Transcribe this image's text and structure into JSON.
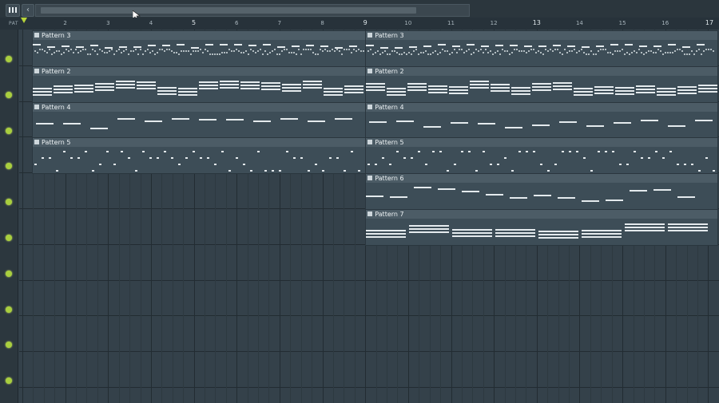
{
  "toolbar": {
    "piano_icon": "piano-keys-icon",
    "back_icon_glyph": "‹"
  },
  "ruler": {
    "pattern_label": "PAT",
    "bars": [
      "2",
      "3",
      "4",
      "5",
      "6",
      "7",
      "8",
      "9",
      "10",
      "11",
      "12",
      "13",
      "14",
      "15",
      "16",
      "17"
    ]
  },
  "tracks": {
    "count": 10
  },
  "clips": [
    {
      "label": "Pattern 3"
    },
    {
      "label": "Pattern 3"
    },
    {
      "label": "Pattern 2"
    },
    {
      "label": "Pattern 2"
    },
    {
      "label": "Pattern 4"
    },
    {
      "label": "Pattern 4"
    },
    {
      "label": "Pattern 5"
    },
    {
      "label": "Pattern 5"
    },
    {
      "label": "Pattern 6"
    },
    {
      "label": "Pattern 7"
    }
  ],
  "colors": {
    "accent": "#a9cf3e",
    "background": "#34414a",
    "clip": "#3d4d57",
    "note": "#e4eaed"
  }
}
